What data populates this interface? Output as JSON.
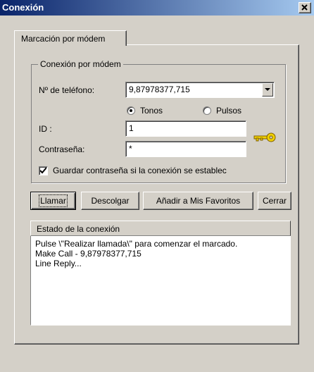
{
  "window": {
    "title": "Conexión"
  },
  "tabs": [
    {
      "label": "Marcación por módem"
    }
  ],
  "group": {
    "title": "Conexión por módem",
    "phone_label": "Nº de teléfono:",
    "phone_value": "9,87978377,715",
    "dial_modes": {
      "tone_label": "Tonos",
      "pulse_label": "Pulsos",
      "selected": "Tonos"
    },
    "id_label": "ID :",
    "id_value": "1",
    "password_label": "Contraseña:",
    "password_value": "*",
    "save_password_label": "Guardar contraseña si la conexión se establec",
    "save_password_checked": true
  },
  "buttons": {
    "call": "Llamar",
    "hangup": "Descolgar",
    "add_favorites": "Añadir a Mis Favoritos",
    "close": "Cerrar"
  },
  "status": {
    "title": "Estado de la conexión",
    "lines": [
      "Pulse \\\"Realizar llamada\\\" para comenzar el marcado.",
      "Make Call - 9,87978377,715",
      "Line Reply..."
    ]
  },
  "icons": {
    "key": "key-icon",
    "close": "close-icon",
    "dropdown": "chevron-down-icon",
    "check": "check-icon"
  },
  "colors": {
    "titlebar_start": "#0a246a",
    "titlebar_end": "#a6caf0",
    "face": "#d4d0c8",
    "key": "#f0d000"
  }
}
